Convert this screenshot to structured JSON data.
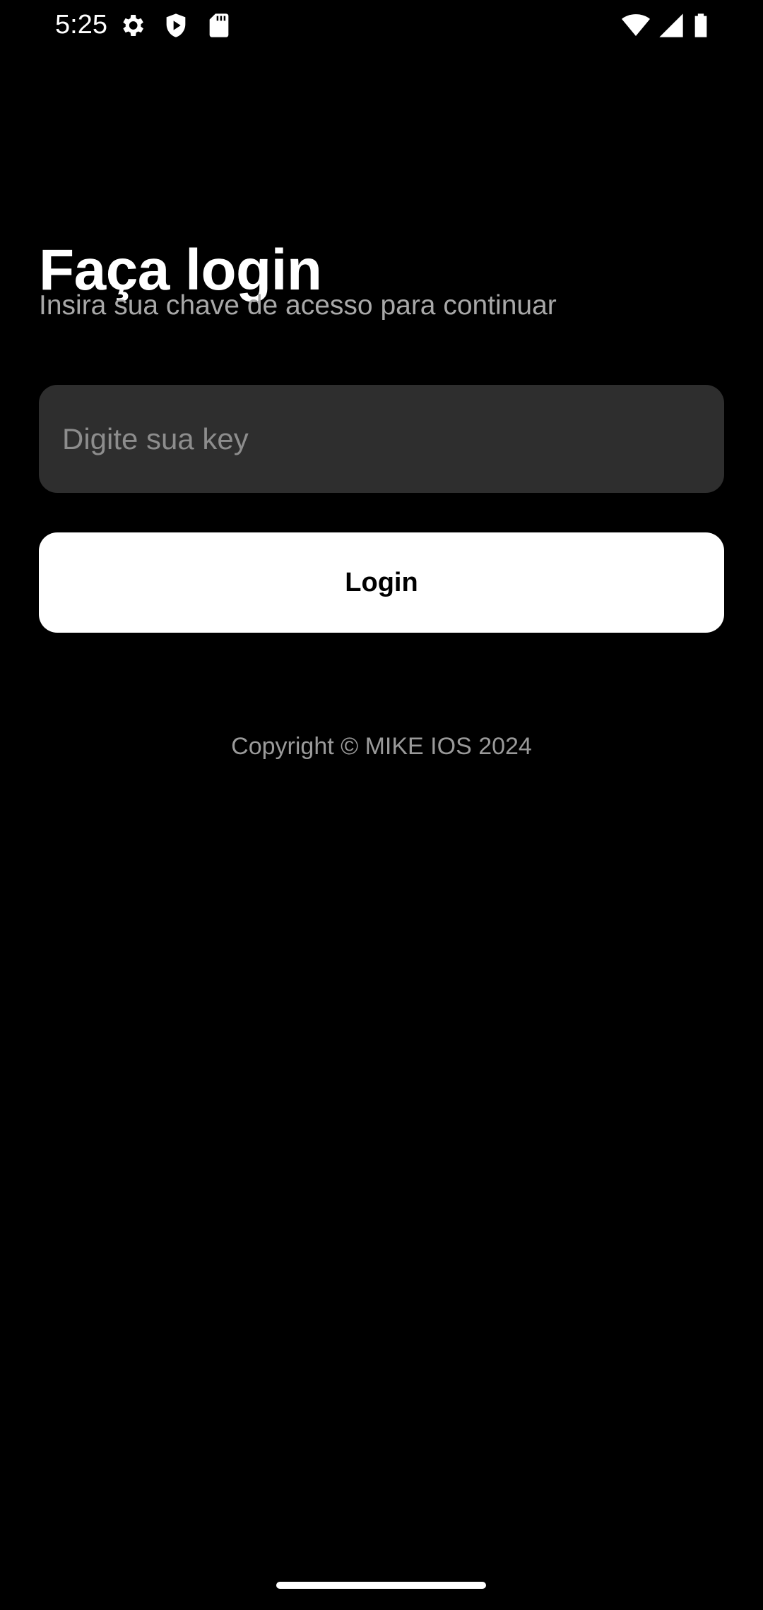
{
  "status_bar": {
    "time": "5:25",
    "left_icons": [
      "gear-icon",
      "shield-icon",
      "sd-card-icon"
    ],
    "right_icons": [
      "wifi-icon",
      "signal-icon",
      "battery-icon"
    ]
  },
  "login": {
    "title": "Faça login",
    "subtitle": "Insira sua chave de acesso para continuar",
    "key_input": {
      "value": "",
      "placeholder": "Digite sua key"
    },
    "login_button_label": "Login"
  },
  "footer": {
    "copyright": "Copyright © MIKE IOS 2024"
  },
  "colors": {
    "background": "#000000",
    "input_background": "#2e2e2e",
    "button_background": "#ffffff",
    "subtitle_text": "#a8a8a8"
  }
}
